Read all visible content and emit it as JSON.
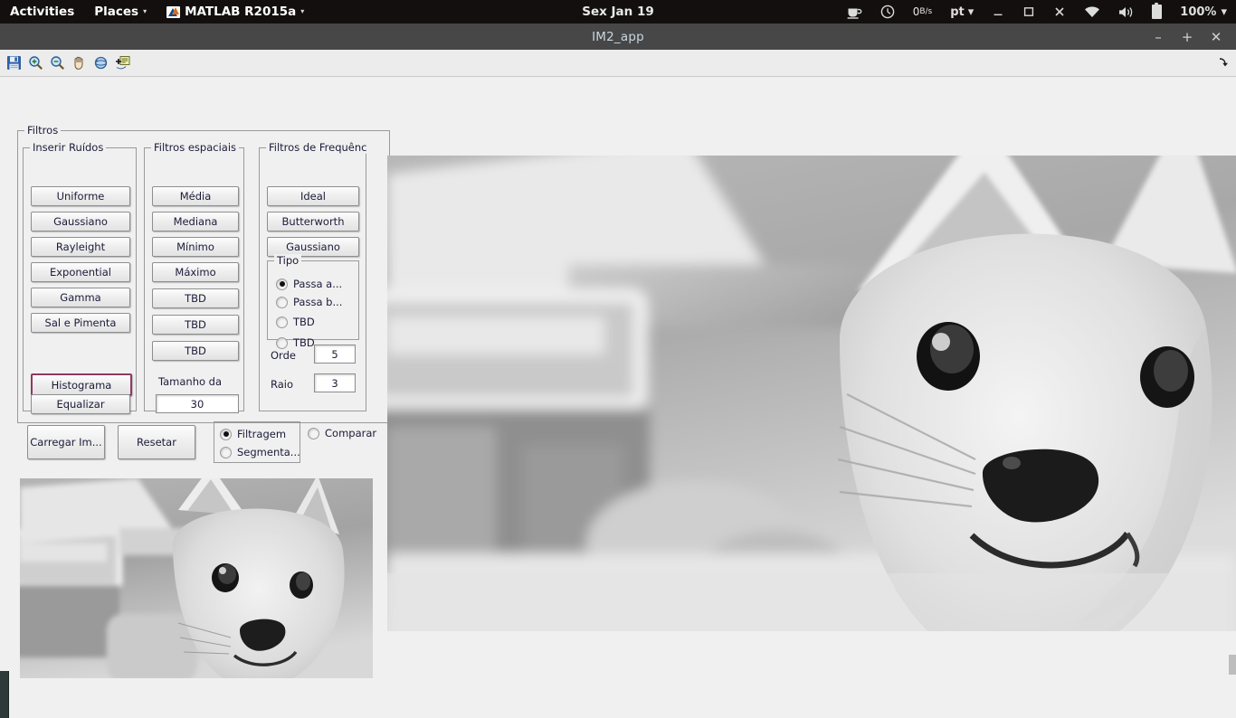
{
  "topbar": {
    "activities": "Activities",
    "places": "Places",
    "app_menu": "MATLAB R2015a",
    "clock": "Sex Jan 19",
    "coffee_icon": "coffee-cup-icon",
    "clock_icon": "clock-icon",
    "net_speed": "0",
    "net_speed_unit": "B/s",
    "language": "pt",
    "minimize": "–",
    "maximize": "□",
    "close": "✕",
    "wifi_icon": "wifi-icon",
    "volume_icon": "volume-icon",
    "battery_icon": "battery-icon",
    "battery_pct": "100%",
    "caret": "▾"
  },
  "window": {
    "title": "IM2_app",
    "minimize": "–",
    "maximize": "+",
    "close": "✕"
  },
  "toolbar": {
    "items": [
      {
        "name": "save-icon",
        "tip": "Save"
      },
      {
        "name": "zoom-in-icon",
        "tip": "Zoom In"
      },
      {
        "name": "zoom-out-icon",
        "tip": "Zoom Out"
      },
      {
        "name": "pan-hand-icon",
        "tip": "Pan"
      },
      {
        "name": "rotate-3d-icon",
        "tip": "Rotate 3D"
      },
      {
        "name": "insert-legend-icon",
        "tip": "Insert Legend"
      }
    ],
    "resize_icon": "resize-arrow-icon"
  },
  "filtros": {
    "legend": "Filtros",
    "ruidos": {
      "legend": "Inserir Ruídos",
      "buttons": [
        "Uniforme",
        "Gaussiano",
        "Rayleight",
        "Exponential",
        "Gamma",
        "Sal e Pimenta"
      ],
      "histograma": "Histograma",
      "equalizar": "Equalizar"
    },
    "espaciais": {
      "legend": "Filtros espaciais",
      "buttons": [
        "Média",
        "Mediana",
        "Mínimo",
        "Máximo",
        "TBD",
        "TBD",
        "TBD"
      ],
      "tamanho_label": "Tamanho da",
      "tamanho_value": "30"
    },
    "frequencia": {
      "legend": "Filtros de Frequência",
      "buttons": [
        "Ideal",
        "Butterworth",
        "Gaussiano"
      ],
      "tipo": {
        "legend": "Tipo",
        "options": [
          "Passa a...",
          "Passa b...",
          "TBD",
          "TBD"
        ],
        "selected_index": 0
      },
      "orde_label": "Orde",
      "orde_value": "5",
      "raio_label": "Raio",
      "raio_value": "3"
    }
  },
  "bottom": {
    "carregar": "Carregar Im...",
    "resetar": "Resetar",
    "mode_options": [
      "Filtragem",
      "Segmenta..."
    ],
    "mode_selected_index": 0,
    "comparar": "Comparar",
    "comparar_selected": false
  },
  "images": {
    "preview_alt": "grayscale-doge-thumbnail",
    "main_alt": "grayscale-doge-main"
  },
  "colors": {
    "desktop_bar": "#120f0e",
    "window_chrome": "#474747",
    "panel_bg": "#f0f0f0",
    "button_face": "#efefef",
    "focus_accent": "#8e3a63",
    "text": "#1b1b3a"
  }
}
